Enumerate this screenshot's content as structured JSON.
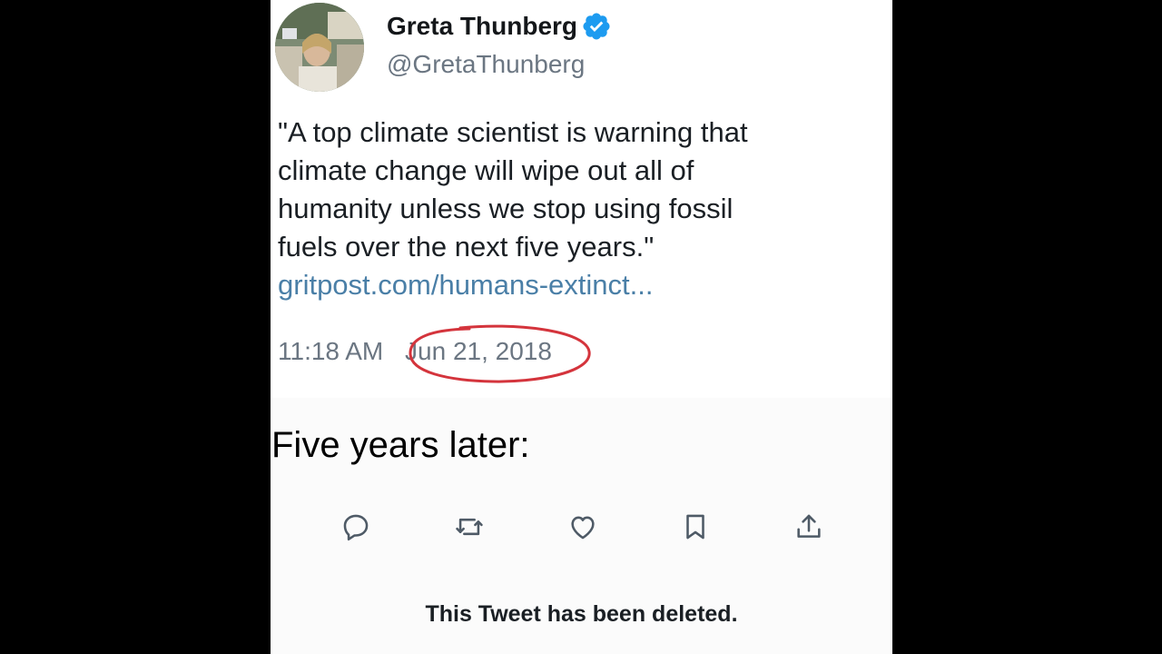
{
  "tweet": {
    "author": {
      "display_name": "Greta Thunberg",
      "handle": "@GretaThunberg",
      "verified": true
    },
    "text_lines": [
      "\"A top climate scientist is warning that",
      "climate change will wipe out all of",
      "humanity unless we stop using fossil",
      "fuels over the next five years.\""
    ],
    "link": "gritpost.com/humans-extinct...",
    "time": "11:18 AM",
    "separator": "·",
    "date": "Jun 21, 2018"
  },
  "caption": "Five years later:",
  "actions": [
    {
      "name": "reply-icon"
    },
    {
      "name": "retweet-icon"
    },
    {
      "name": "like-icon"
    },
    {
      "name": "bookmark-icon"
    },
    {
      "name": "share-icon"
    }
  ],
  "deleted_notice": "This Tweet has been deleted.",
  "colors": {
    "verified_badge": "#1d9bf0",
    "link": "#4a7fa7",
    "date_circle": "#d4343c",
    "muted_text": "#6b7682",
    "icon": "#4e5a66"
  }
}
